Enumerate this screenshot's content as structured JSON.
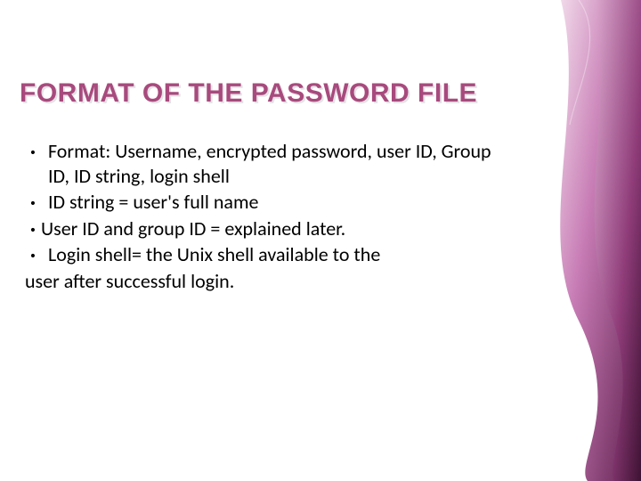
{
  "slide": {
    "title": "FORMAT OF THE PASSWORD FILE",
    "bullets": [
      "Format: Username, encrypted password, user ID, Group ID, ID string,  login shell",
      "ID string = user's full name",
      "User ID and group ID = explained later.",
      "Login shell= the Unix shell available to the"
    ],
    "continuation": "user after successful login."
  },
  "theme": {
    "accent": "#a84a7d",
    "band_light": "#e9c8e0",
    "band_mid": "#b35ea0",
    "band_dark": "#5b1b49"
  }
}
